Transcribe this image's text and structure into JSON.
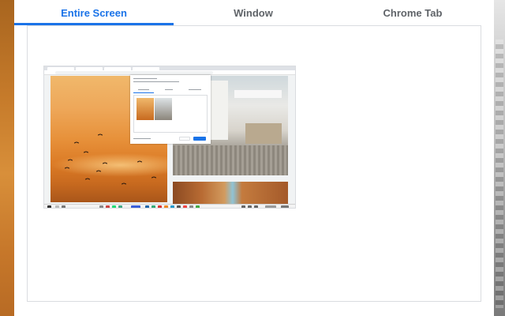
{
  "tabs": [
    {
      "label": "Entire Screen",
      "active": true
    },
    {
      "label": "Window",
      "active": false
    },
    {
      "label": "Chrome Tab",
      "active": false
    }
  ],
  "colors": {
    "accent": "#1a73e8",
    "inactive_tab": "#5f6368",
    "panel_border": "#dadce0"
  },
  "thumbnail": {
    "kind": "entire-screen-preview",
    "icon": "screen-preview-icon"
  }
}
